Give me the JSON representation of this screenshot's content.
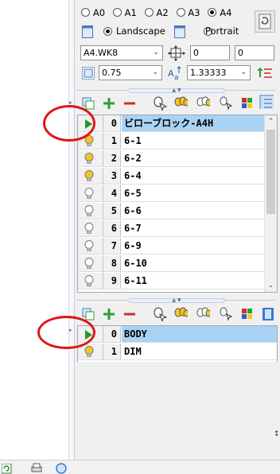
{
  "paper_size": {
    "options": [
      "A0",
      "A1",
      "A2",
      "A3",
      "A4"
    ],
    "selected": "A4"
  },
  "orientation": {
    "landscape_label": "Landscape",
    "portrait_label": "Portrait",
    "selected": "Landscape"
  },
  "file_combo": {
    "value": "A4.WK8"
  },
  "offset_x": {
    "value": "0"
  },
  "offset_y": {
    "value": "0"
  },
  "scale_combo": {
    "value": "0.75"
  },
  "ratio_combo": {
    "value": "1.33333"
  },
  "layers": {
    "rows": [
      {
        "num": "0",
        "name": "ビローブロック-A4H",
        "state": "active"
      },
      {
        "num": "1",
        "name": "6-1",
        "state": "on"
      },
      {
        "num": "2",
        "name": "6-2",
        "state": "on"
      },
      {
        "num": "3",
        "name": "6-4",
        "state": "on"
      },
      {
        "num": "4",
        "name": "6-5",
        "state": "off"
      },
      {
        "num": "5",
        "name": "6-6",
        "state": "off"
      },
      {
        "num": "6",
        "name": "6-7",
        "state": "off"
      },
      {
        "num": "7",
        "name": "6-9",
        "state": "off"
      },
      {
        "num": "8",
        "name": "6-10",
        "state": "off"
      },
      {
        "num": "9",
        "name": "6-11",
        "state": "off"
      }
    ],
    "scroll_fraction": 0.56
  },
  "blocks": {
    "rows": [
      {
        "num": "0",
        "name": "BODY",
        "state": "active"
      },
      {
        "num": "1",
        "name": "DIM",
        "state": "on"
      }
    ]
  },
  "icons": {
    "paper": "page-icon",
    "rotate": "rotate-icon",
    "move": "move-offset-icon",
    "scale": "scale-icon",
    "ratio": "ratio-icon",
    "sort": "sort-icon",
    "copy": "copy-layer-icon",
    "add": "plus-icon",
    "remove": "minus-icon",
    "bulbs": "bulb-icon",
    "palette": "color-palette-icon",
    "grid": "grid-icon"
  },
  "colors": {
    "selection": "#a9d3f5",
    "play": "#1e9a2a",
    "highlight_ellipse": "#e01414",
    "bulb_on": "#f3c623"
  }
}
